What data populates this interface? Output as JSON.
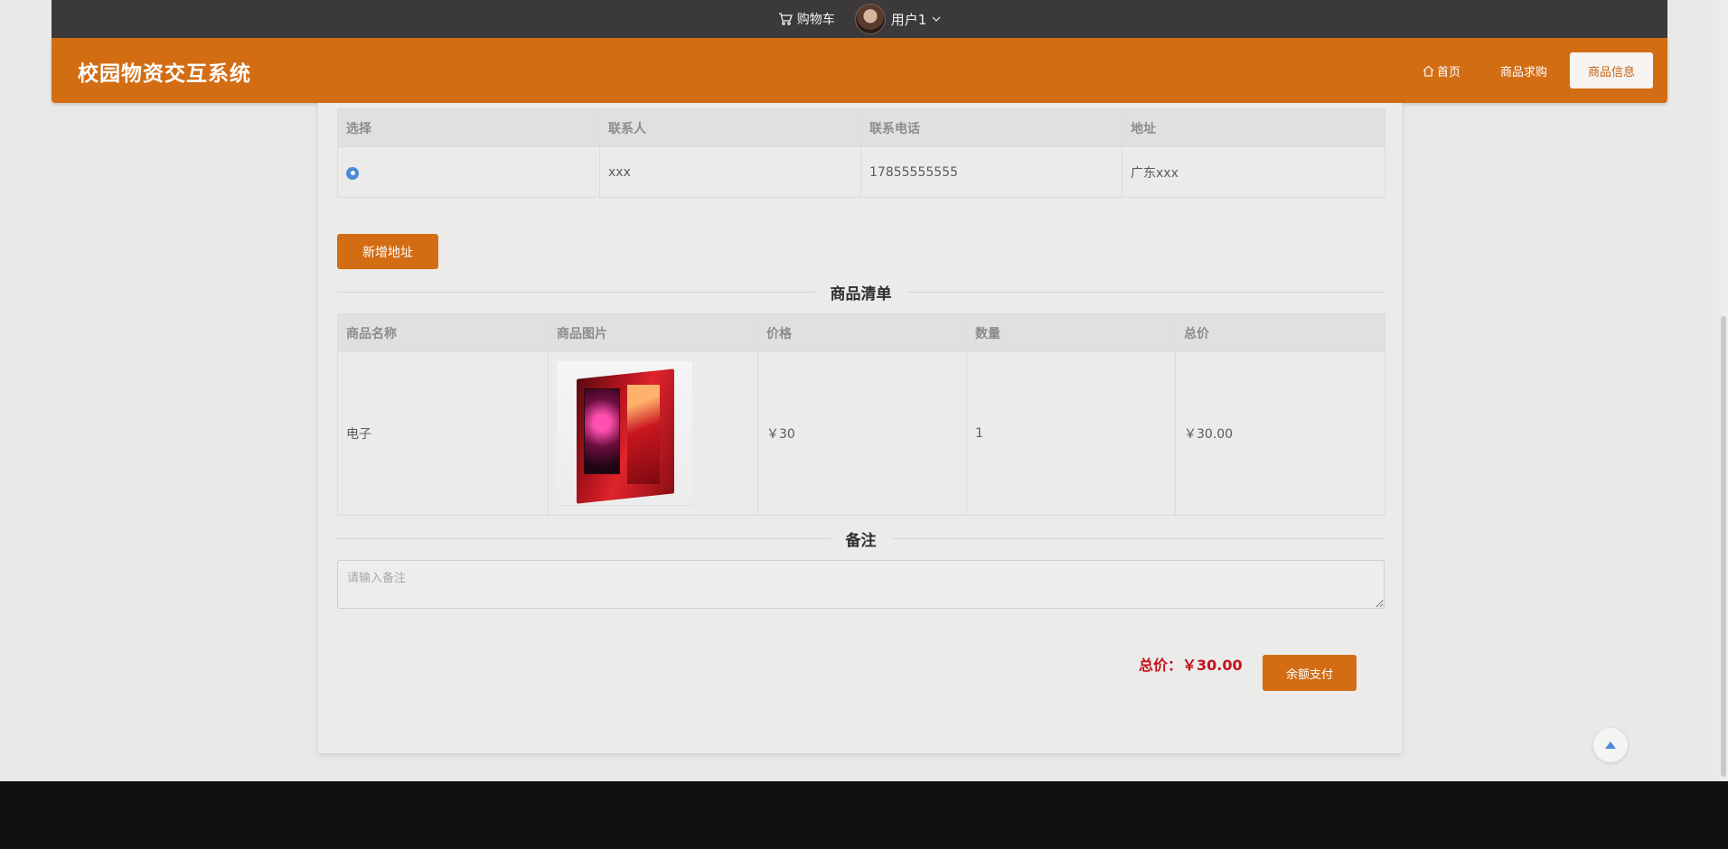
{
  "topbar": {
    "cart_label": "购物车",
    "user_name": "用户1"
  },
  "header": {
    "title": "校园物资交互系统",
    "nav": [
      {
        "label": "首页",
        "icon": "home-icon"
      },
      {
        "label": "商品求购"
      },
      {
        "label": "商品信息",
        "active": true
      }
    ]
  },
  "address_table": {
    "headers": [
      "选择",
      "联系人",
      "联系电话",
      "地址"
    ],
    "rows": [
      {
        "selected": true,
        "contact": "xxx",
        "phone": "17855555555",
        "address": "广东xxx"
      }
    ]
  },
  "add_address_label": "新增地址",
  "goods_section_title": "商品清单",
  "goods_table": {
    "headers": [
      "商品名称",
      "商品图片",
      "价格",
      "数量",
      "总价"
    ],
    "rows": [
      {
        "name": "电子",
        "price": "￥30",
        "quantity": "1",
        "total": "￥30.00"
      }
    ]
  },
  "remark_section_title": "备注",
  "remark": {
    "placeholder": "请输入备注",
    "value": ""
  },
  "summary": {
    "total_label": "总价：",
    "total_value": "￥30.00",
    "pay_label": "余额支付"
  },
  "colors": {
    "brand": "#d36d14",
    "topbar": "#3c393b",
    "total_text": "#c5121b",
    "radio": "#4b8bd6",
    "footer": "#111112"
  }
}
